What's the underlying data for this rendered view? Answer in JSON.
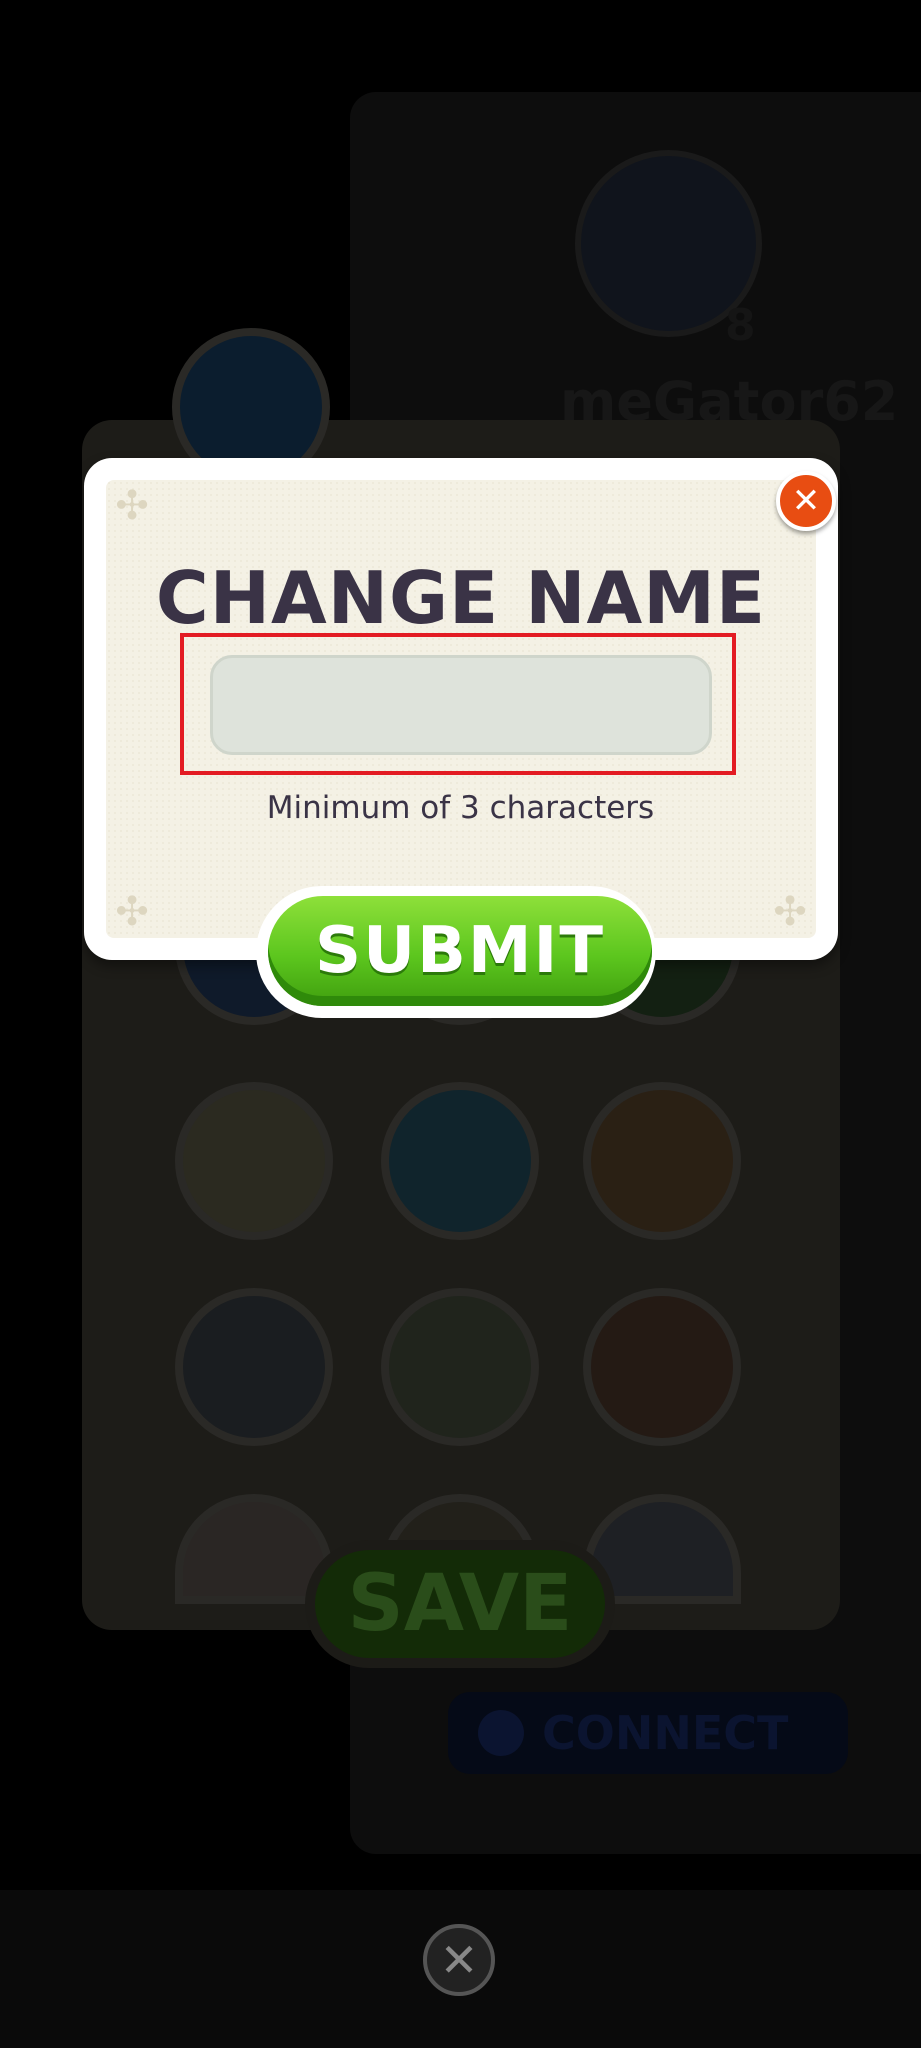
{
  "background": {
    "username": "meGator62",
    "save_label": "SAVE",
    "connect_label": "CONNECT"
  },
  "dialog": {
    "title": "CHANGE NAME",
    "input_value": "",
    "hint": "Minimum of 3 characters",
    "submit_label": "SUBMIT",
    "close_glyph": "✕"
  },
  "bottom": {
    "close_glyph": "✕"
  },
  "colors": {
    "accent_green": "#5cc61e",
    "close_orange": "#e84d12",
    "title_text": "#3a3346",
    "highlight_red": "#e31b23"
  }
}
